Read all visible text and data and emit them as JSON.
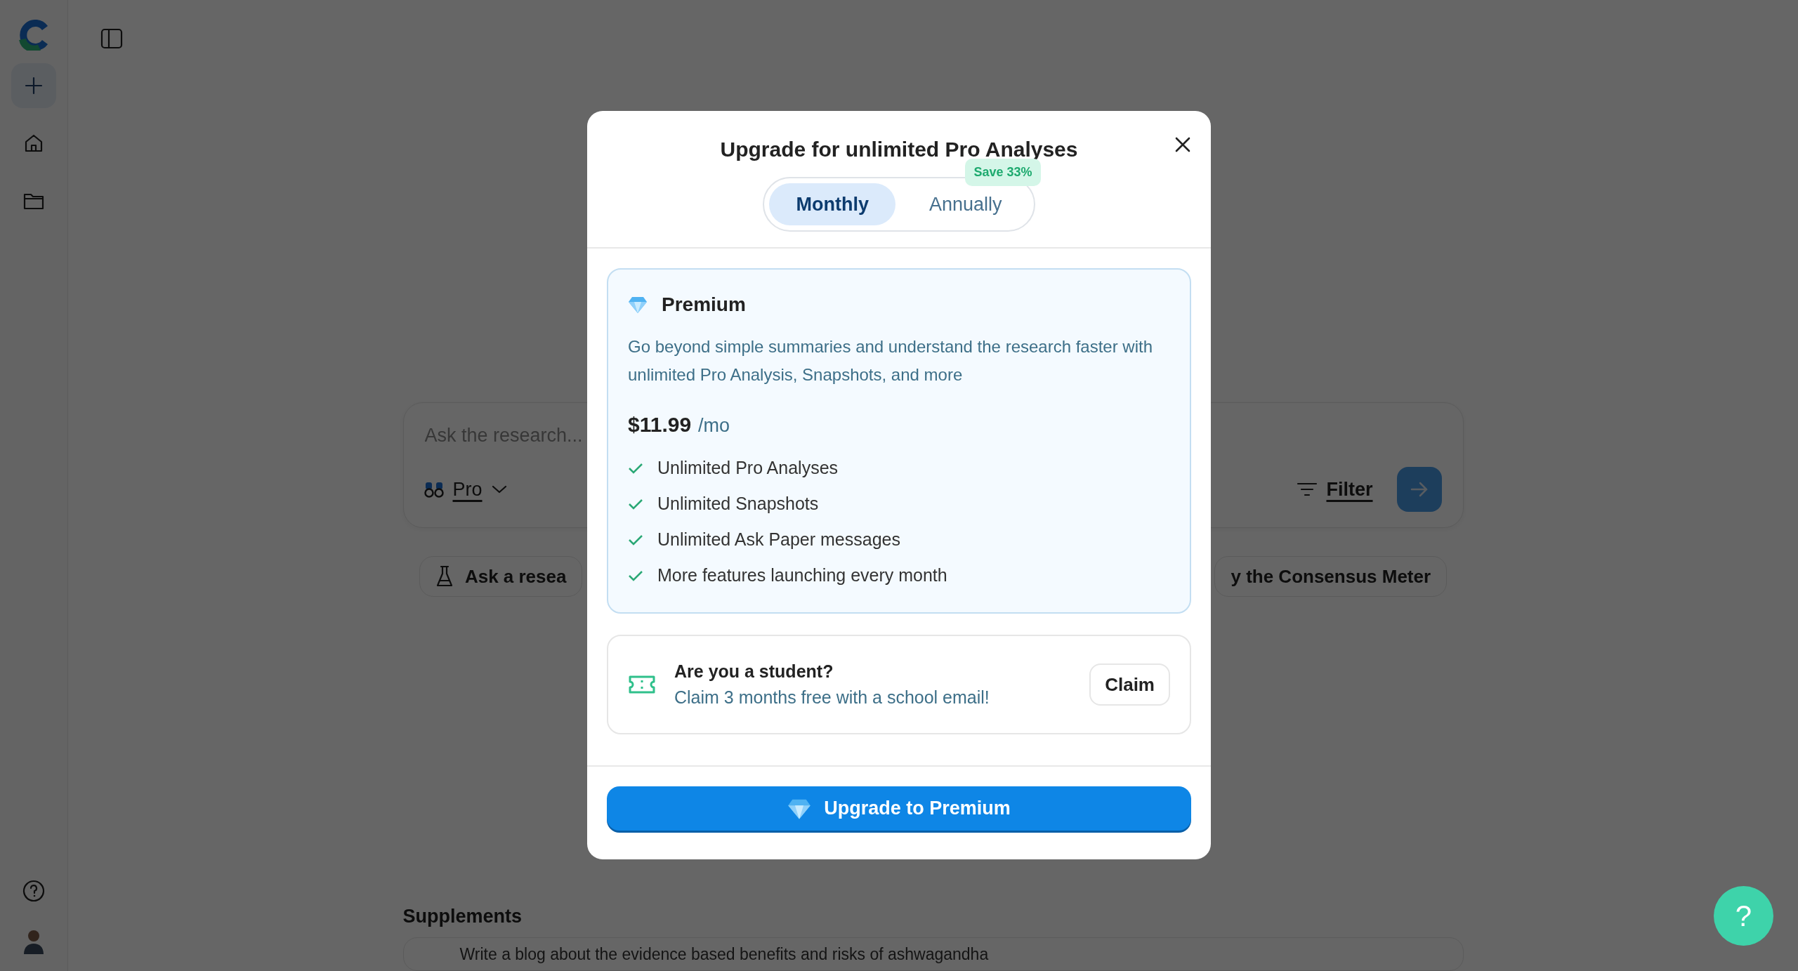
{
  "search": {
    "placeholder": "Ask the research...",
    "mode": "Pro",
    "filter": "Filter"
  },
  "suggestions": [
    {
      "kind": "flask",
      "label": "Ask a resea"
    },
    {
      "kind": "meter",
      "label": "y the Consensus Meter"
    }
  ],
  "section": {
    "title": "Supplements",
    "rows": [
      "Write a blog about the evidence based benefits and risks of ashwagandha"
    ]
  },
  "modal": {
    "title": "Upgrade for unlimited Pro Analyses",
    "billing": [
      {
        "label": "Monthly",
        "selected": true
      },
      {
        "label": "Annually",
        "selected": false,
        "badge": "Save 33%"
      }
    ],
    "plan": {
      "name": "Premium",
      "description": "Go beyond simple summaries and understand the research faster with unlimited Pro Analysis, Snapshots, and more",
      "price": "$11.99",
      "period": "/mo",
      "features": [
        "Unlimited Pro Analyses",
        "Unlimited Snapshots",
        "Unlimited Ask Paper messages",
        "More features launching every month"
      ]
    },
    "student": {
      "title": "Are you a student?",
      "text": "Claim 3 months free with a school email!",
      "button": "Claim"
    },
    "cta": "Upgrade to Premium"
  },
  "help_button": "?"
}
